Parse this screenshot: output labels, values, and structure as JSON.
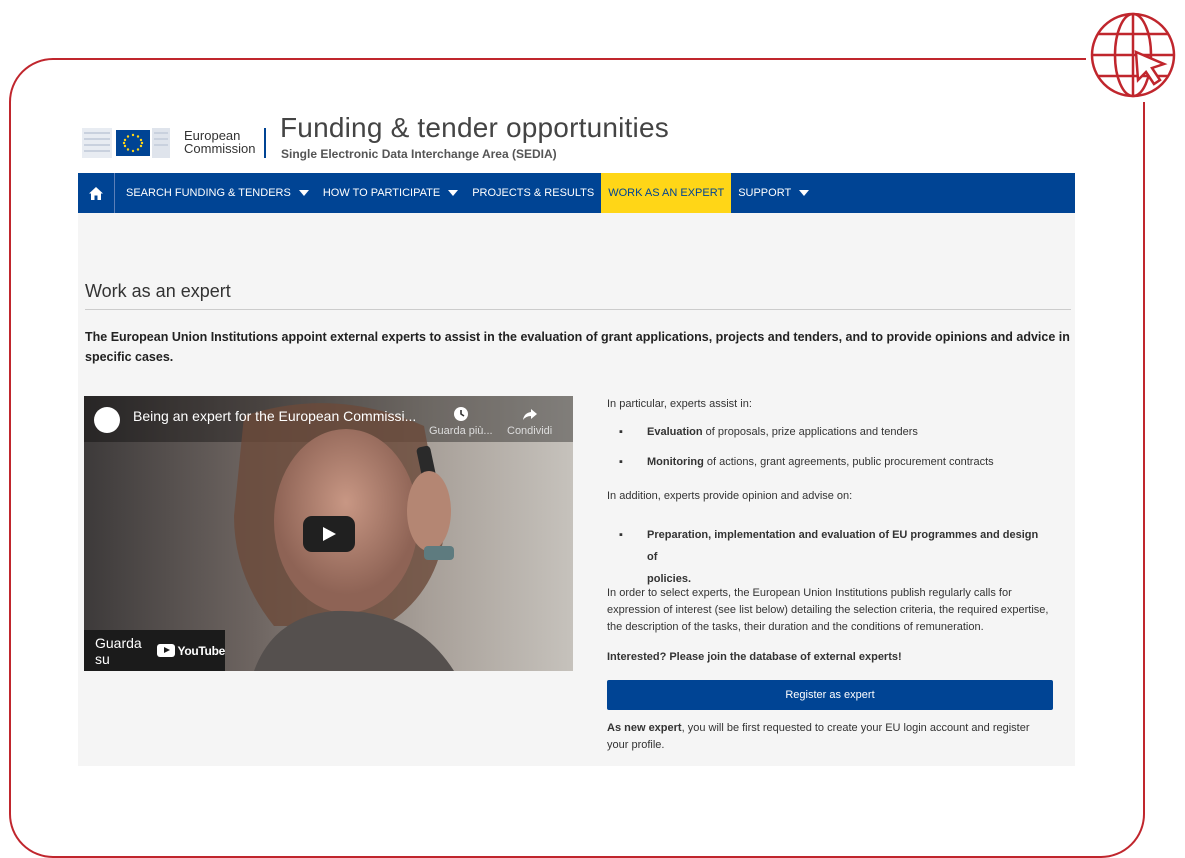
{
  "brand": {
    "line1": "European",
    "line2": "Commission",
    "site_title": "Funding & tender opportunities",
    "site_subtitle": "Single Electronic Data Interchange Area (SEDIA)"
  },
  "nav": {
    "home_icon": "home-icon",
    "items": [
      {
        "label": "SEARCH FUNDING & TENDERS",
        "dropdown": true
      },
      {
        "label": "HOW TO PARTICIPATE",
        "dropdown": true
      },
      {
        "label": "PROJECTS & RESULTS",
        "dropdown": false
      },
      {
        "label": "WORK AS AN EXPERT",
        "dropdown": false,
        "active": true
      },
      {
        "label": "SUPPORT",
        "dropdown": true
      }
    ]
  },
  "page": {
    "title": "Work as an expert",
    "intro": "The European Union Institutions appoint external experts to assist in the evaluation of grant applications, projects and tenders, and to provide opinions and advice in specific cases."
  },
  "video": {
    "title": "Being an expert for the European Commissi...",
    "watch_later": "Guarda più...",
    "share": "Condividi",
    "watch_on": "Guarda su",
    "youtube": "YouTube"
  },
  "content": {
    "assist_intro": "In particular, experts assist in:",
    "bullet1_bold": "Evaluation",
    "bullet1_rest": " of proposals, prize applications and tenders",
    "bullet2_bold": "Monitoring",
    "bullet2_rest": " of actions, grant agreements, public procurement contracts",
    "advise_intro": "In addition, experts provide opinion and advise on:",
    "bullet3_line1": "Preparation, implementation and evaluation of EU programmes and design of",
    "bullet3_line2": "policies.",
    "calls_text": "In order to select experts, the European Union Institutions publish regularly calls for expression of interest (see list below) detailing the selection criteria, the required expertise, the description of the tasks, their duration and the conditions of remuneration.",
    "interested": "Interested? Please join the database of external experts!",
    "register_button": "Register as expert",
    "new_expert_bold": "As new expert",
    "new_expert_rest": ", you will be first requested to create your EU login account and register your profile."
  },
  "colors": {
    "nav_bg": "#004494",
    "active_tab": "#ffd617",
    "frame": "#c0262d"
  }
}
